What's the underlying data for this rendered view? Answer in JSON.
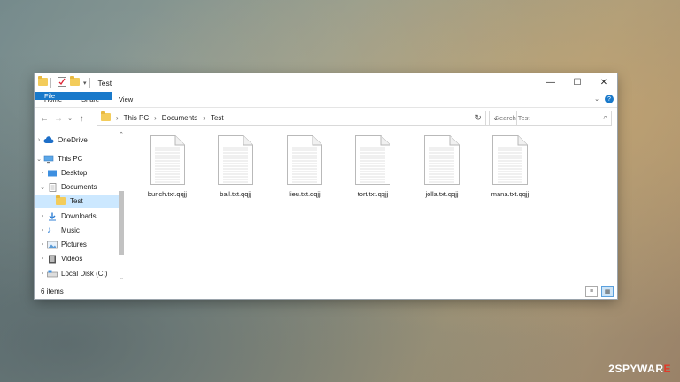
{
  "window": {
    "title": "Test",
    "controls": {
      "minimize": "—",
      "maximize": "☐",
      "close": "✕"
    }
  },
  "ribbon": {
    "tabs": [
      {
        "label": "File",
        "active": true
      },
      {
        "label": "Home"
      },
      {
        "label": "Share"
      },
      {
        "label": "View"
      }
    ]
  },
  "address": {
    "breadcrumbs": [
      "This PC",
      "Documents",
      "Test"
    ],
    "search_placeholder": "Search Test"
  },
  "sidebar": {
    "items": [
      {
        "label": "OneDrive",
        "icon": "cloud-icon",
        "expanded": false,
        "indent": 0
      },
      {
        "label": "This PC",
        "icon": "computer-icon",
        "expanded": true,
        "indent": 0
      },
      {
        "label": "Desktop",
        "icon": "desktop-icon",
        "expanded": false,
        "indent": 1
      },
      {
        "label": "Documents",
        "icon": "documents-icon",
        "expanded": true,
        "indent": 1
      },
      {
        "label": "Test",
        "icon": "folder-icon",
        "selected": true,
        "indent": 2
      },
      {
        "label": "Downloads",
        "icon": "download-icon",
        "expanded": false,
        "indent": 1
      },
      {
        "label": "Music",
        "icon": "music-icon",
        "expanded": false,
        "indent": 1
      },
      {
        "label": "Pictures",
        "icon": "pictures-icon",
        "expanded": false,
        "indent": 1
      },
      {
        "label": "Videos",
        "icon": "videos-icon",
        "expanded": false,
        "indent": 1
      },
      {
        "label": "Local Disk (C:)",
        "icon": "drive-icon",
        "expanded": false,
        "indent": 1
      }
    ]
  },
  "files": [
    {
      "name": "bunch.txt.qqjj"
    },
    {
      "name": "bail.txt.qqjj"
    },
    {
      "name": "lieu.txt.qqjj"
    },
    {
      "name": "tort.txt.qqjj"
    },
    {
      "name": "jolla.txt.qqjj"
    },
    {
      "name": "mana.txt.qqjj"
    }
  ],
  "status": {
    "item_count": "6 items"
  },
  "watermark": {
    "prefix": "2SPYWAR",
    "suffix": "E"
  },
  "colors": {
    "accent": "#1979ca",
    "selection": "#cce8ff",
    "folder": "#f3cc5b"
  }
}
